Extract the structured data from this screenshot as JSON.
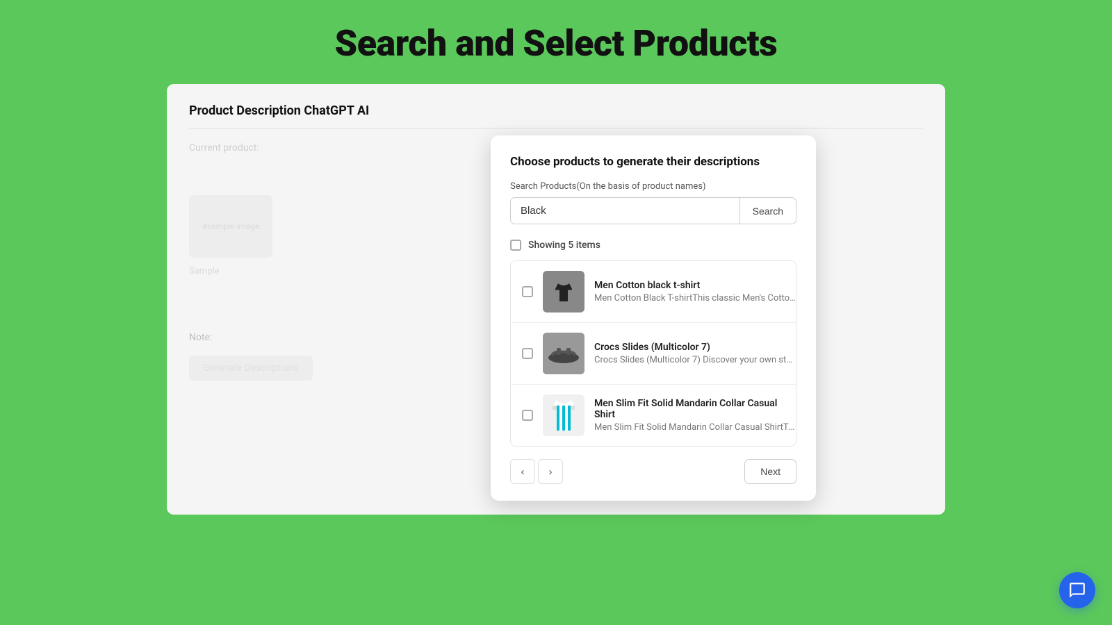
{
  "page": {
    "title": "Search and Select Products",
    "app_name": "Product Description ChatGPT AI"
  },
  "left_panel": {
    "current_product_label": "Current product:",
    "sample_image_text": "#sample-image",
    "sample_label": "Sample",
    "generate_btn": "Generate Descriptions"
  },
  "modal": {
    "title": "Choose products to generate their descriptions",
    "search_label": "Search Products(On the basis of product names)",
    "search_placeholder": "Black",
    "search_value": "Black",
    "search_button": "Search",
    "showing_items": "Showing 5 items",
    "products": [
      {
        "id": 1,
        "name": "Men Cotton black t-shirt",
        "description": "Men Cotton Black T-shirtThis classic Men's Cotton ...",
        "image_type": "tshirt"
      },
      {
        "id": 2,
        "name": "Crocs Slides (Multicolor 7)",
        "description": "Crocs Slides (Multicolor 7) Discover your own styl...",
        "image_type": "slides"
      },
      {
        "id": 3,
        "name": "Men Slim Fit Solid Mandarin Collar Casual Shirt",
        "description": "Men Slim Fit Solid Mandarin Collar Casual ShirtThi...",
        "image_type": "shirt"
      }
    ],
    "next_button": "Next"
  },
  "icons": {
    "chevron_left": "‹",
    "chevron_right": "›",
    "chat": "chat-icon"
  }
}
